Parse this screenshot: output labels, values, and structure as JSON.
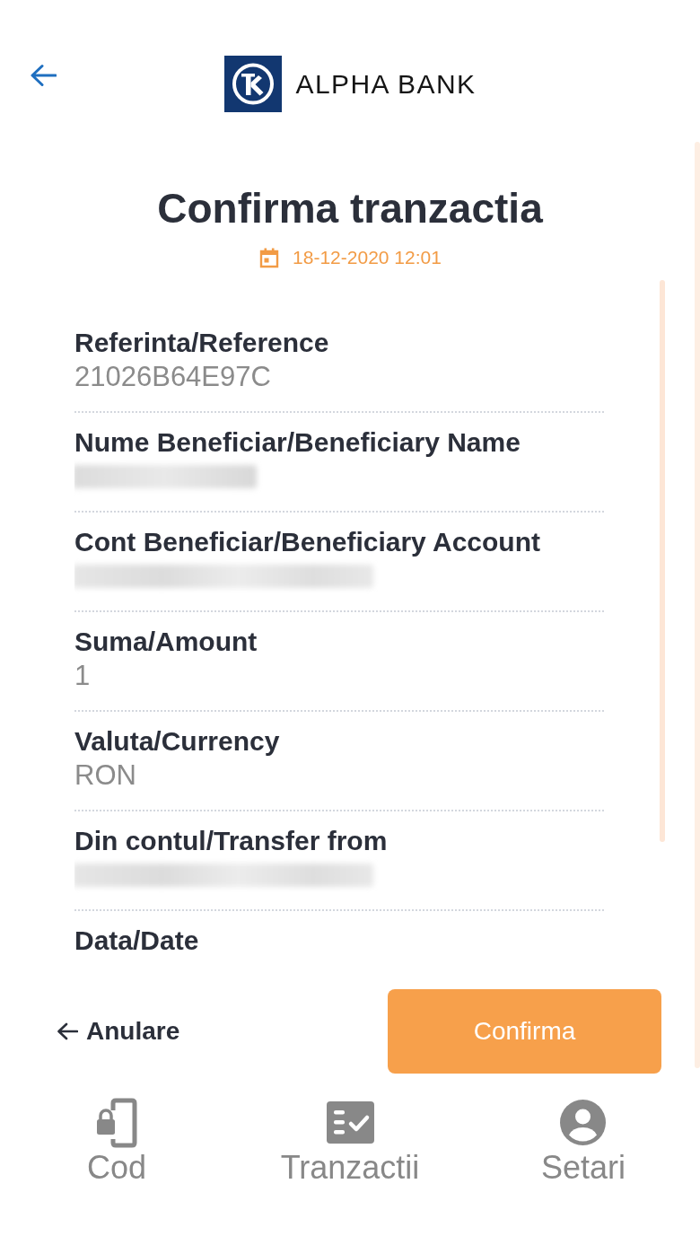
{
  "header": {
    "brand": "ALPHA BANK"
  },
  "title": "Confirma tranzactia",
  "date": "18-12-2020 12:01",
  "details": [
    {
      "kind": "text",
      "label": "Referinta/Reference",
      "value": "21026B64E97C"
    },
    {
      "kind": "blurred",
      "label": "Nume Beneficiar/Beneficiary Name"
    },
    {
      "kind": "blurred",
      "label": "Cont Beneficiar/Beneficiary Account"
    },
    {
      "kind": "text",
      "label": "Suma/Amount",
      "value": "1"
    },
    {
      "kind": "text",
      "label": "Valuta/Currency",
      "value": "RON"
    },
    {
      "kind": "blurred",
      "label": "Din contul/Transfer from"
    },
    {
      "kind": "text",
      "label": "Data/Date"
    }
  ],
  "actions": {
    "cancel": "Anulare",
    "confirm": "Confirma"
  },
  "tabs": [
    {
      "label": "Cod",
      "selected": false
    },
    {
      "label": "Tranzactii",
      "selected": false
    },
    {
      "label": "Setari",
      "selected": false
    }
  ]
}
